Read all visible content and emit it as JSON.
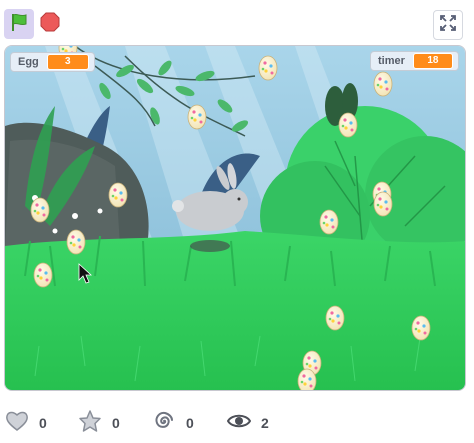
{
  "toolbar": {
    "green_flag_icon": "green-flag-icon",
    "stop_icon": "stop-sign-icon",
    "fullscreen_icon": "fullscreen-icon",
    "flag_active_bg": "#d9d3f2"
  },
  "stage": {
    "monitors": {
      "egg": {
        "label": "Egg",
        "value": "3"
      },
      "timer": {
        "label": "timer",
        "value": "18"
      }
    },
    "monitor_value_color": "#ff8c1a",
    "scene": {
      "sky_color": "#9ccbe3",
      "grass_color": "#2ecc5a",
      "bush_color": "#3ad16a",
      "rock_color": "#4f5c5a"
    }
  },
  "stats": {
    "loves": "0",
    "favorites": "0",
    "remixes": "0",
    "views": "2"
  }
}
